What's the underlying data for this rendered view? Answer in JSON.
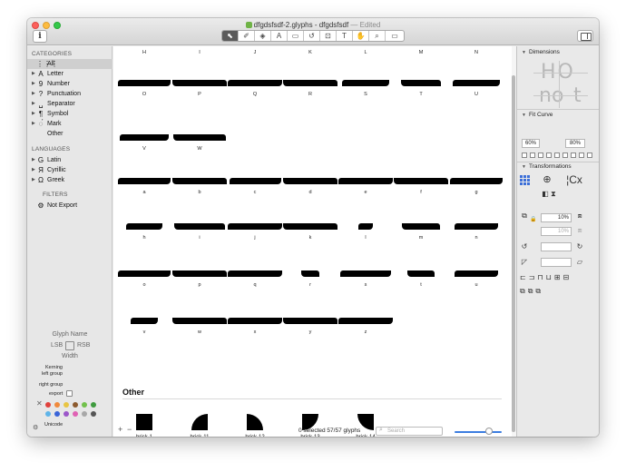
{
  "window": {
    "title": "dfgdsfsdf-2.glyphs - dfgdsfsdf",
    "edited": " — Edited",
    "info_label": "i"
  },
  "toolbar": {
    "tools": [
      {
        "name": "select-tool",
        "glyph": "⬉"
      },
      {
        "name": "draw-tool",
        "glyph": "✐"
      },
      {
        "name": "eraser-tool",
        "glyph": "◈"
      },
      {
        "name": "shape-tool",
        "glyph": "A"
      },
      {
        "name": "primitives-tool",
        "glyph": "▭"
      },
      {
        "name": "rotate-tool",
        "glyph": "↺"
      },
      {
        "name": "scale-tool",
        "glyph": "⊡"
      },
      {
        "name": "text-tool",
        "glyph": "T"
      },
      {
        "name": "hand-tool",
        "glyph": "✋"
      },
      {
        "name": "zoom-tool",
        "glyph": "⌕"
      },
      {
        "name": "preview-tool",
        "glyph": "▭"
      }
    ]
  },
  "sidebar": {
    "categories_heading": "CATEGORIES",
    "categories": [
      {
        "label": "All",
        "icon": "⋮⋮⋮",
        "selected": true
      },
      {
        "label": "Letter",
        "icon": "A"
      },
      {
        "label": "Number",
        "icon": "9"
      },
      {
        "label": "Punctuation",
        "icon": "?"
      },
      {
        "label": "Separator",
        "icon": "␣"
      },
      {
        "label": "Symbol",
        "icon": "¶"
      },
      {
        "label": "Mark",
        "icon": "◌́"
      },
      {
        "label": "Other",
        "icon": ""
      }
    ],
    "languages_heading": "LANGUAGES",
    "languages": [
      {
        "label": "Latin",
        "icon": "G"
      },
      {
        "label": "Cyrillic",
        "icon": "Я"
      },
      {
        "label": "Greek",
        "icon": "Ω"
      }
    ],
    "filters_heading": "FILTERS",
    "filters": [
      {
        "label": "Not Export",
        "icon": "⚙"
      }
    ],
    "glyph_name": "Glyph Name",
    "lsb": "LSB",
    "rsb": "RSB",
    "width": "Width",
    "kerning": "Kerning",
    "left_group": "left group",
    "right_group": "right group",
    "export": "export",
    "unicode": "Unicode",
    "colors": [
      "#e0413c",
      "#f08a3c",
      "#e8c544",
      "#8c5a2e",
      "#72c14c",
      "#3f9b3f",
      "#5fb4e8",
      "#3a64d8",
      "#9c57c9",
      "#e062b4",
      "#a8a8a8",
      "#555555"
    ]
  },
  "glyphs": {
    "rows": [
      {
        "labels": [
          "H",
          "I",
          "J",
          "K",
          "L",
          "M",
          "N"
        ]
      },
      {
        "labels": [
          "O",
          "P",
          "Q",
          "R",
          "S",
          "T",
          "U"
        ]
      },
      {
        "labels": [
          "V",
          "W"
        ]
      },
      {
        "labels": [
          "a",
          "b",
          "c",
          "d",
          "e",
          "f",
          "g"
        ]
      },
      {
        "labels": [
          "h",
          "i",
          "j",
          "k",
          "l",
          "m",
          "n"
        ]
      },
      {
        "labels": [
          "o",
          "p",
          "q",
          "r",
          "s",
          "t",
          "u"
        ]
      },
      {
        "labels": [
          "v",
          "w",
          "x",
          "y",
          "z"
        ]
      }
    ],
    "other_heading": "Other",
    "others": [
      {
        "label": "brick-1",
        "shape": "square"
      },
      {
        "label": "brick-11",
        "shape": "quarter-tl"
      },
      {
        "label": "brick-12",
        "shape": "quarter-tr"
      },
      {
        "label": "brick-13",
        "shape": "quarter-bl"
      },
      {
        "label": "brick-14",
        "shape": "quarter-br"
      }
    ]
  },
  "status": {
    "add": "+",
    "remove": "−",
    "count": "0 selected 57/57 glyphs",
    "search_placeholder": "Search"
  },
  "panel": {
    "dimensions": "Dimensions",
    "fit_curve": "Fit Curve",
    "fit_low": "60%",
    "fit_high": "80%",
    "transformations": "Transformations",
    "scale_x": "10%",
    "scale_y": "10%",
    "preview_text": "HO",
    "preview_text2": "no",
    "preview_text3": "t"
  }
}
